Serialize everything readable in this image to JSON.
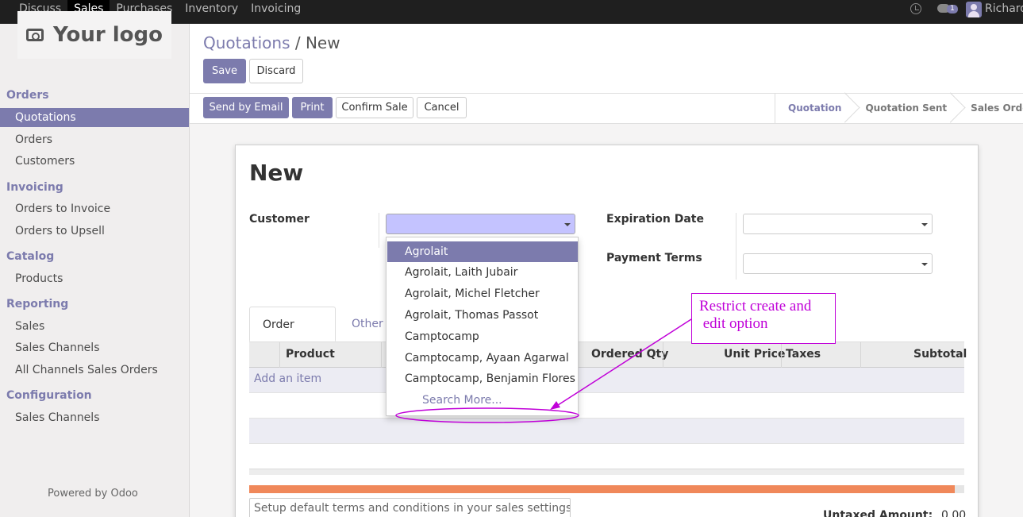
{
  "topbar": {
    "menu": [
      "Discuss",
      "Sales",
      "Purchases",
      "Inventory",
      "Invoicing"
    ],
    "active": "Sales",
    "chat_count": "1",
    "username": "Richard"
  },
  "sidebar": {
    "logo_text": "Your logo",
    "sections": [
      {
        "title": "Orders",
        "items": [
          "Quotations",
          "Orders",
          "Customers"
        ]
      },
      {
        "title": "Invoicing",
        "items": [
          "Orders to Invoice",
          "Orders to Upsell"
        ]
      },
      {
        "title": "Catalog",
        "items": [
          "Products"
        ]
      },
      {
        "title": "Reporting",
        "items": [
          "Sales",
          "Sales Channels",
          "All Channels Sales Orders"
        ]
      },
      {
        "title": "Configuration",
        "items": [
          "Sales Channels"
        ]
      }
    ],
    "active_item": "Quotations",
    "powered_by": "Powered by Odoo"
  },
  "breadcrumb": {
    "parent": "Quotations",
    "separator": "/",
    "current": "New"
  },
  "buttons": {
    "save": "Save",
    "discard": "Discard",
    "send_email": "Send by Email",
    "print": "Print",
    "confirm": "Confirm Sale",
    "cancel": "Cancel"
  },
  "stages": [
    "Quotation",
    "Quotation Sent",
    "Sales Order"
  ],
  "current_stage": "Quotation",
  "form": {
    "title": "New",
    "customer_label": "Customer",
    "customer_value": "",
    "expiration_label": "Expiration Date",
    "payment_terms_label": "Payment Terms"
  },
  "tabs": [
    "Order Lines",
    "Other I"
  ],
  "table": {
    "headers": [
      "Product",
      "Ordered Qty",
      "Unit Price",
      "Taxes",
      "Subtotal"
    ],
    "add_item": "Add an item"
  },
  "notes_placeholder": "Setup default terms and conditions in your sales settings ...",
  "untaxed_label": "Untaxed Amount:",
  "untaxed_value": "0.00",
  "dropdown": {
    "items": [
      "Agrolait",
      "Agrolait, Laith Jubair",
      "Agrolait, Michel Fletcher",
      "Agrolait, Thomas Passot",
      "Camptocamp",
      "Camptocamp, Ayaan Agarwal",
      "Camptocamp, Benjamin Flores"
    ],
    "active": "Agrolait",
    "search_more": "Search More..."
  },
  "annotation": {
    "line1": "Restrict create and",
    "line2": " edit option"
  },
  "colors": {
    "brand": "#7c7bad",
    "annotation": "#c000d8",
    "progress": "#f0885a"
  }
}
